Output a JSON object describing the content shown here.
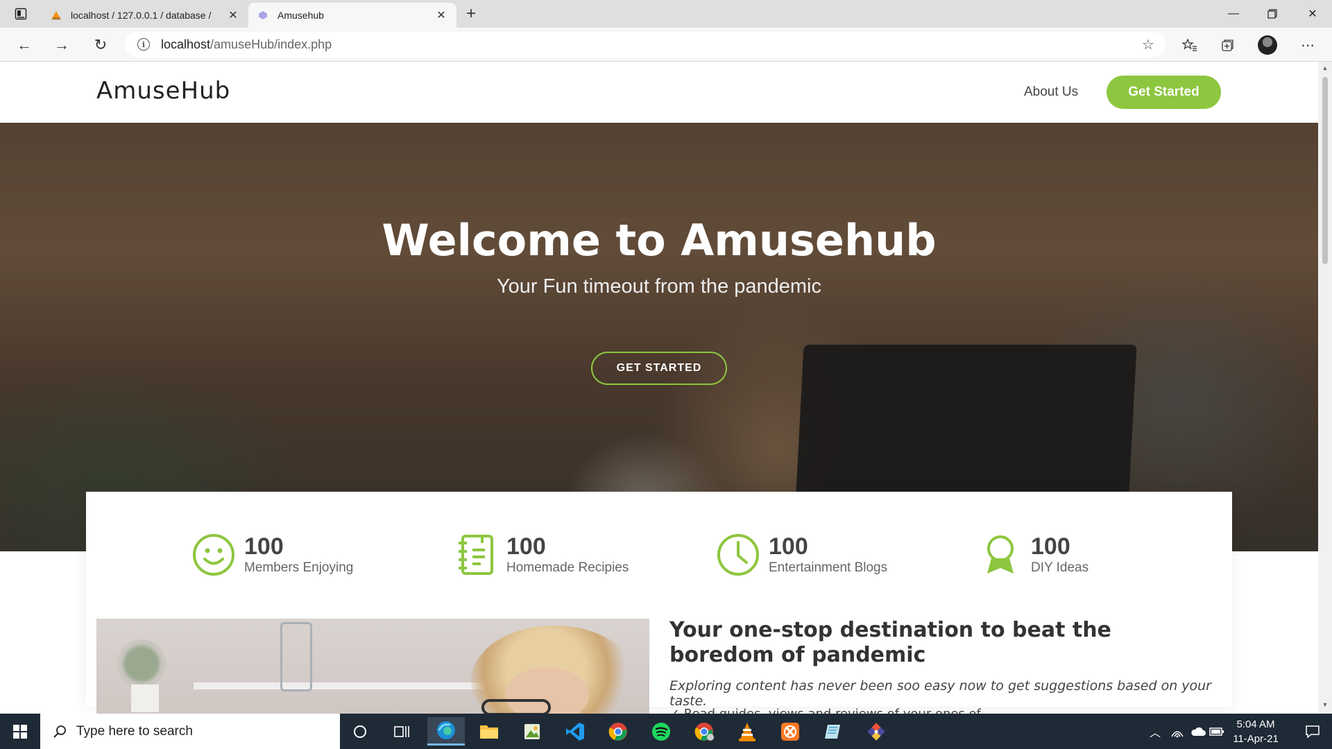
{
  "browser": {
    "tabs": [
      {
        "title": "localhost / 127.0.0.1 / database /",
        "active": false,
        "favicon": "phpmyadmin-icon"
      },
      {
        "title": "Amusehub",
        "active": true,
        "favicon": "amusehub-icon"
      }
    ],
    "new_tab_label": "+",
    "address": {
      "host": "localhost",
      "path": "/amuseHub/index.php"
    }
  },
  "header": {
    "brand": "AmuseHub",
    "nav": {
      "about": "About Us",
      "get_started": "Get Started"
    },
    "accent_color": "#8dc63f"
  },
  "hero": {
    "title": "Welcome to Amusehub",
    "subtitle": "Your Fun timeout from the pandemic",
    "cta": "GET STARTED"
  },
  "stats": [
    {
      "icon": "smiley-icon",
      "value": "100",
      "label": "Members Enjoying"
    },
    {
      "icon": "notebook-icon",
      "value": "100",
      "label": "Homemade Recipies"
    },
    {
      "icon": "clock-icon",
      "value": "100",
      "label": "Entertainment Blogs"
    },
    {
      "icon": "award-icon",
      "value": "100",
      "label": "DIY Ideas"
    }
  ],
  "about": {
    "heading": "Your one-stop destination to beat the boredom of pandemic",
    "description": "Exploring content has never been soo easy now to get suggestions based on your taste.",
    "bullet": "✓ Read guides, views and reviews of your ones of"
  },
  "taskbar": {
    "search_placeholder": "Type here to search",
    "time": "5:04 AM",
    "date": "11-Apr-21"
  }
}
